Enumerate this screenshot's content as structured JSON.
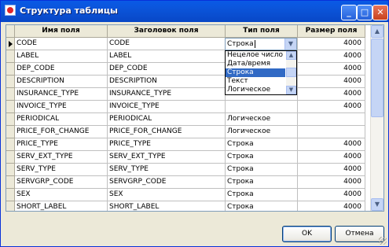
{
  "window": {
    "title": "Структура таблицы",
    "controls": {
      "minimize": "_",
      "maximize": "□",
      "close": "✕"
    }
  },
  "grid": {
    "columns": [
      "Имя поля",
      "Заголовок поля",
      "Тип поля",
      "Размер поля"
    ],
    "rows": [
      {
        "name": "CODE",
        "caption": "CODE",
        "type": "Строка",
        "size": "4000"
      },
      {
        "name": "LABEL",
        "caption": "LABEL",
        "type": "",
        "size": "4000"
      },
      {
        "name": "DEP_CODE",
        "caption": "DEP_CODE",
        "type": "",
        "size": "4000"
      },
      {
        "name": "DESCRIPTION",
        "caption": "DESCRIPTION",
        "type": "",
        "size": "4000"
      },
      {
        "name": "INSURANCE_TYPE",
        "caption": "INSURANCE_TYPE",
        "type": "",
        "size": "4000"
      },
      {
        "name": "INVOICE_TYPE",
        "caption": "INVOICE_TYPE",
        "type": "",
        "size": "4000"
      },
      {
        "name": "PERIODICAL",
        "caption": "PERIODICAL",
        "type": "Логическое",
        "size": ""
      },
      {
        "name": "PRICE_FOR_CHANGE",
        "caption": "PRICE_FOR_CHANGE",
        "type": "Логическое",
        "size": ""
      },
      {
        "name": "PRICE_TYPE",
        "caption": "PRICE_TYPE",
        "type": "Строка",
        "size": "4000"
      },
      {
        "name": "SERV_EXT_TYPE",
        "caption": "SERV_EXT_TYPE",
        "type": "Строка",
        "size": "4000"
      },
      {
        "name": "SERV_TYPE",
        "caption": "SERV_TYPE",
        "type": "Строка",
        "size": "4000"
      },
      {
        "name": "SERVGRP_CODE",
        "caption": "SERVGRP_CODE",
        "type": "Строка",
        "size": "4000"
      },
      {
        "name": "SEX",
        "caption": "SEX",
        "type": "Строка",
        "size": "4000"
      },
      {
        "name": "SHORT_LABEL",
        "caption": "SHORT_LABEL",
        "type": "Строка",
        "size": "4000"
      }
    ],
    "editor": {
      "value": "Строка"
    },
    "dropdown": {
      "options": [
        "Нецелое число",
        "Дата/время",
        "Строка",
        "Текст",
        "Логическое"
      ],
      "selected": "Строка"
    }
  },
  "buttons": {
    "ok": "OK",
    "cancel": "Отмена"
  },
  "icons": [
    "window-icon",
    "minimize-icon",
    "maximize-icon",
    "close-icon",
    "row-indicator-icon",
    "dropdown-arrow-icon",
    "scroll-up-icon",
    "scroll-down-icon",
    "resize-grip-icon"
  ]
}
